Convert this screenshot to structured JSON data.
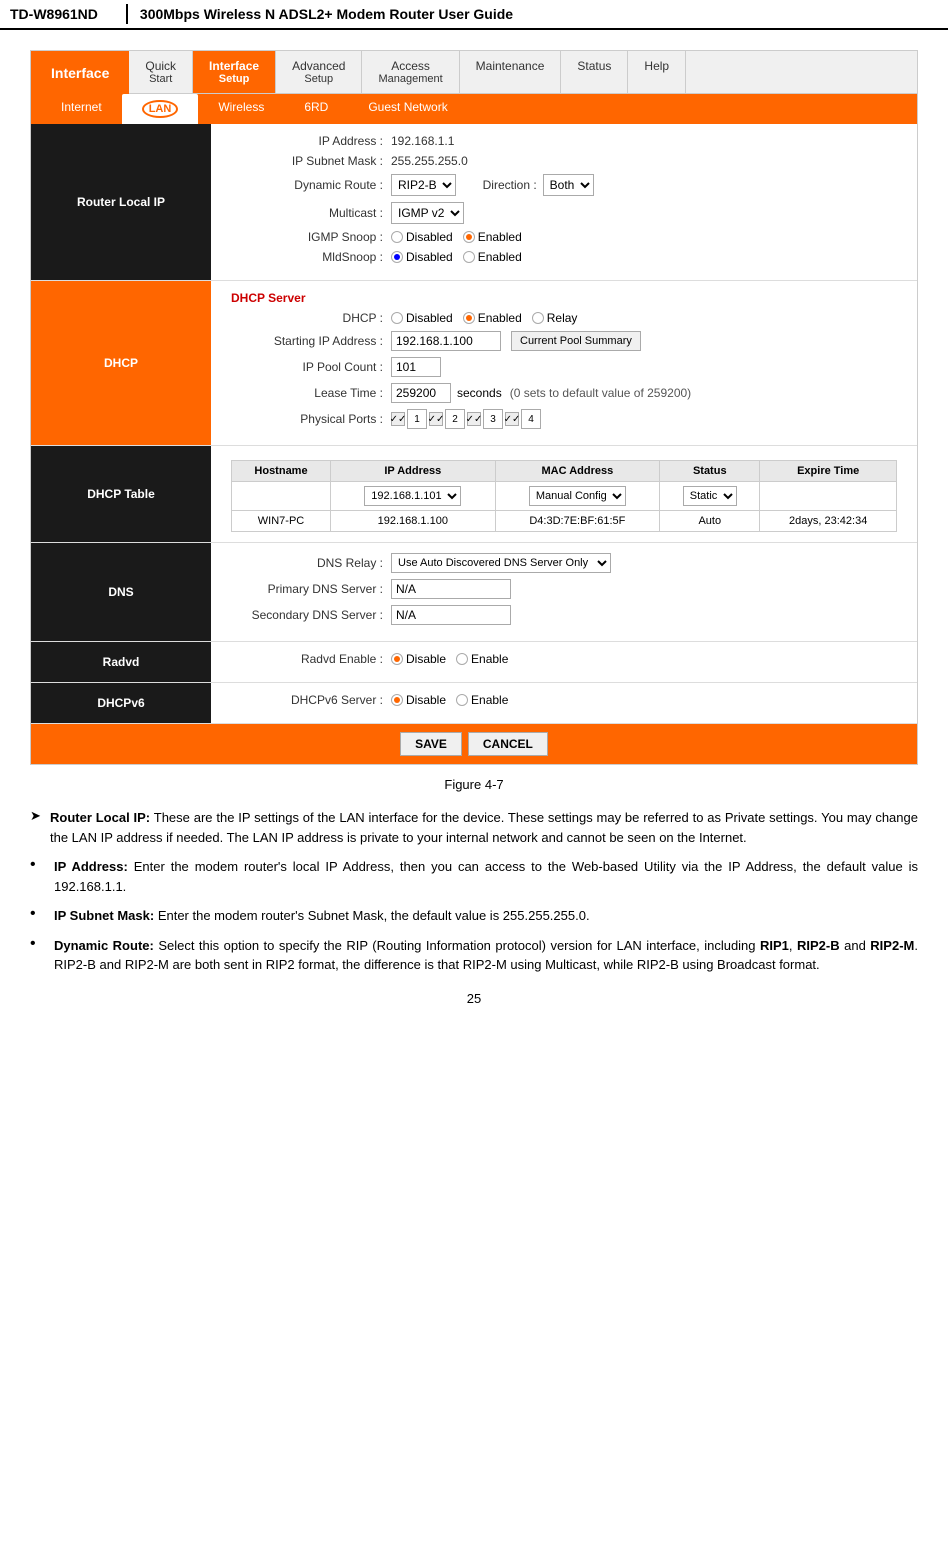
{
  "header": {
    "brand": "TD-W8961ND",
    "title": "300Mbps Wireless N ADSL2+ Modem Router User Guide"
  },
  "nav": {
    "items": [
      {
        "label": "Quick",
        "sub": "Start",
        "active": false
      },
      {
        "label": "Interface",
        "sub": "Setup",
        "active": true
      },
      {
        "label": "Advanced",
        "sub": "Setup",
        "active": false
      },
      {
        "label": "Access",
        "sub": "Management",
        "active": false
      },
      {
        "label": "Maintenance",
        "sub": "",
        "active": false
      },
      {
        "label": "Status",
        "sub": "",
        "active": false
      },
      {
        "label": "Help",
        "sub": "",
        "active": false
      }
    ],
    "interface_label": "Interface"
  },
  "sub_nav": {
    "items": [
      "Internet",
      "LAN",
      "Wireless",
      "6RD",
      "Guest Network"
    ],
    "active": "LAN"
  },
  "router_local_ip": {
    "section_label": "Router Local IP",
    "ip_address_label": "IP Address :",
    "ip_address_value": "192.168.1.1",
    "subnet_mask_label": "IP Subnet Mask :",
    "subnet_mask_value": "255.255.255.0",
    "dynamic_route_label": "Dynamic Route :",
    "dynamic_route_value": "RIP2-B",
    "direction_label": "Direction :",
    "direction_value": "Both",
    "multicast_label": "Multicast :",
    "multicast_value": "IGMP v2",
    "igmp_snoop_label": "IGMP Snoop :",
    "igmp_snoop_disabled": "Disabled",
    "igmp_snoop_enabled": "Enabled",
    "mldsnoop_label": "MldSnoop :",
    "mldsnoop_disabled": "Disabled",
    "mldsnoop_enabled": "Enabled"
  },
  "dhcp": {
    "section_label": "DHCP",
    "server_label": "DHCP Server",
    "dhcp_label": "DHCP :",
    "dhcp_disabled": "Disabled",
    "dhcp_enabled": "Enabled",
    "dhcp_relay": "Relay",
    "starting_ip_label": "Starting IP Address :",
    "starting_ip_value": "192.168.1.100",
    "pool_btn_label": "Current Pool Summary",
    "ip_pool_label": "IP Pool Count :",
    "ip_pool_value": "101",
    "lease_time_label": "Lease Time :",
    "lease_time_value": "259200",
    "lease_time_unit": "seconds",
    "lease_time_note": "(0 sets to default value of 259200)",
    "physical_ports_label": "Physical Ports :",
    "ports": [
      "1",
      "2",
      "3",
      "4"
    ]
  },
  "dhcp_table": {
    "section_label": "DHCP Table",
    "columns": [
      "Hostname",
      "IP Address",
      "MAC Address",
      "Status",
      "Expire Time"
    ],
    "row1": {
      "hostname": "",
      "ip_address": "192.168.1.101",
      "mac_address": "Manual Config",
      "status": "Static",
      "expire_time": ""
    },
    "row2": {
      "hostname": "WIN7-PC",
      "ip_address": "192.168.1.100",
      "mac_address": "D4:3D:7E:BF:61:5F",
      "status": "Auto",
      "expire_time": "2days, 23:42:34"
    }
  },
  "dns": {
    "section_label": "DNS",
    "relay_label": "DNS Relay :",
    "relay_value": "Use Auto Discovered DNS Server Only",
    "primary_label": "Primary DNS Server :",
    "primary_value": "N/A",
    "secondary_label": "Secondary DNS Server :",
    "secondary_value": "N/A"
  },
  "radvd": {
    "section_label": "Radvd",
    "enable_label": "Radvd Enable :",
    "disable_text": "Disable",
    "enable_text": "Enable"
  },
  "dhcpv6": {
    "section_label": "DHCPv6",
    "server_label": "DHCPv6 Server :",
    "disable_text": "Disable",
    "enable_text": "Enable"
  },
  "actions": {
    "save_label": "SAVE",
    "cancel_label": "CANCEL"
  },
  "figure": {
    "caption": "Figure 4-7"
  },
  "description": {
    "intro_marker": "➤",
    "intro_bold": "Router Local IP:",
    "intro_text": " These are the IP settings of the LAN interface for the device. These settings may be referred to as Private settings. You may change the LAN IP address if needed. The LAN IP address is private to your internal network and cannot be seen on the Internet.",
    "bullets": [
      {
        "bold": "IP Address:",
        "text": " Enter the modem router's local IP Address, then you can access to the Web-based Utility via the IP Address, the default value is 192.168.1.1."
      },
      {
        "bold": "IP Subnet Mask:",
        "text": " Enter the modem router's Subnet Mask, the default value is 255.255.255.0."
      },
      {
        "bold": "Dynamic Route:",
        "text": " Select this option to specify the RIP (Routing Information protocol) version for LAN interface, including RIP1, RIP2-B and RIP2-M. RIP2-B and RIP2-M are both sent in RIP2 format, the difference is that RIP2-M using Multicast, while RIP2-B using Broadcast format."
      }
    ]
  },
  "page_number": "25"
}
